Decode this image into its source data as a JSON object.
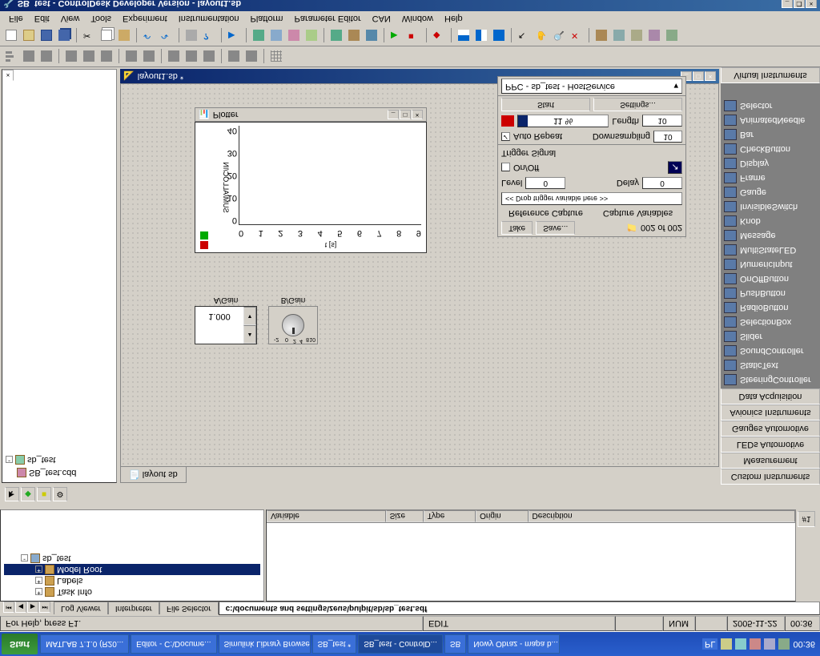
{
  "taskbar": {
    "start": "Start",
    "items": [
      "MATLAB 7.1.0 (R20...",
      "Editor - C:\\Docume...",
      "Simulink Library Browser",
      "SB_test *",
      "SB_test - ControlD...",
      "SB",
      "Nowy Obraz - mapa b..."
    ],
    "active_index": 4,
    "lang": "PL",
    "time": "00:36"
  },
  "statusbar": {
    "help": "For Help, press F1.",
    "mode": "EDIT",
    "num": "NUM",
    "date": "2005-11-22",
    "time": "00:36"
  },
  "bottom_tabs": {
    "items": [
      "Log Viewer",
      "Interpreter",
      "File Selector"
    ],
    "path": "c:\\documents and settings\\zeus\\pulpit\\sb\\sb_test.sdf"
  },
  "tree": {
    "root": "sb_test",
    "children": [
      "Model Root",
      "Labels",
      "Task Info"
    ]
  },
  "var_headers": [
    "Variable",
    "Size",
    "Type",
    "Origin",
    "Description"
  ],
  "num_label": "#1",
  "nav_tree": {
    "root": "sb_test",
    "child": "SB_test.cdd"
  },
  "layout_tab": "layout sb",
  "again": {
    "label": "A/Gain",
    "value": "1.000"
  },
  "bgain": {
    "label": "B/Gain",
    "ticks": [
      "-2",
      "0",
      "2",
      "4",
      "5",
      "8",
      "10"
    ]
  },
  "plotter": {
    "title": "Plotter",
    "xlabel": "t [s]",
    "ylabel": "SUM/ALLOC/IN",
    "xticks": [
      "0",
      "1",
      "2",
      "3",
      "4",
      "5",
      "6",
      "7",
      "8",
      "9"
    ],
    "yticks": [
      "0",
      "10",
      "20",
      "30",
      "40"
    ]
  },
  "capture": {
    "ref_label": "Reference Capture",
    "var_label": "Capture Variables",
    "take": "Take",
    "save": "Save...",
    "count": "002 of 002",
    "drop": "<< Drop trigger variable here >>",
    "level_l": "Level",
    "level_v": "0",
    "delay_l": "Delay",
    "delay_v": "0",
    "onoff": "On/Off",
    "trigger": "Trigger Signal",
    "auto": "Auto Repeat",
    "downs_l": "Downsampling",
    "downs_v": "10",
    "pct": "11 %",
    "len_l": "Length",
    "len_v": "10",
    "start": "Start",
    "settings": "Settings...",
    "service": "PPC - sb_test - HostService"
  },
  "layout_title": "layout1.sb *",
  "palette_headers": [
    "Custom Instruments",
    "Measurement",
    "LEDs Automotive",
    "Gauges Automotive",
    "Avionics Instruments",
    "Data Acquisition"
  ],
  "palette_items": [
    "SteeringController",
    "StaticText",
    "SoundController",
    "Slider",
    "SelectionBox",
    "RadioButton",
    "PushButton",
    "OnOffButton",
    "NumericInput",
    "MultiStateLED",
    "Message",
    "Knob",
    "InvisibleSwitch",
    "Gauge",
    "Frame",
    "Display",
    "CheckButton",
    "Bar",
    "AnimatedNeedle",
    "Selector"
  ],
  "palette_footer": "Virtual Instruments",
  "menu": [
    "File",
    "Edit",
    "View",
    "Tools",
    "Experiment",
    "Instrumentation",
    "Platform",
    "Parameter Editor",
    "CAN",
    "Window",
    "Help"
  ],
  "title": "SB_test - ControlDesk Developer Version - layout1.sb"
}
